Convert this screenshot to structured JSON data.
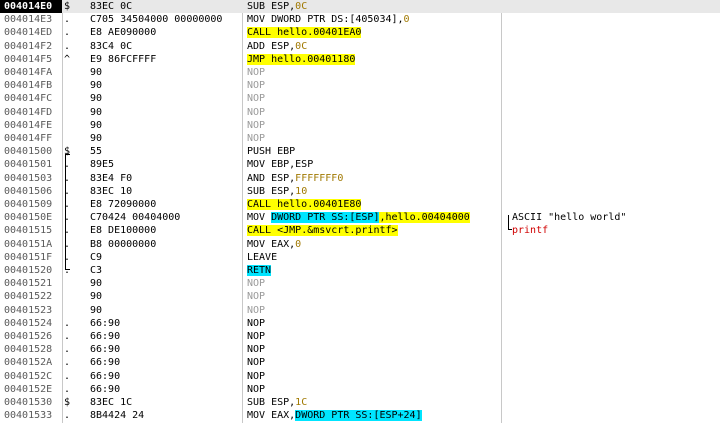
{
  "rows": [
    {
      "addr": "004014E0",
      "mark": "$",
      "hex": "83EC 0C",
      "asm": [
        {
          "t": "SUB ESP,"
        },
        {
          "t": "0C",
          "c": "num"
        }
      ],
      "cmt": [],
      "sel": true
    },
    {
      "addr": "004014E3",
      "mark": ".",
      "hex": "C705 34504000 00000000",
      "asm": [
        {
          "t": "MOV DWORD PTR DS:[405034],"
        },
        {
          "t": "0",
          "c": "num"
        }
      ],
      "cmt": []
    },
    {
      "addr": "004014ED",
      "mark": ".",
      "hex": "E8 AE090000",
      "asm": [
        {
          "t": "CALL hello.00401EA0",
          "c": "hl-y"
        }
      ],
      "cmt": []
    },
    {
      "addr": "004014F2",
      "mark": ".",
      "hex": "83C4 0C",
      "asm": [
        {
          "t": "ADD ESP,"
        },
        {
          "t": "0C",
          "c": "num"
        }
      ],
      "cmt": []
    },
    {
      "addr": "004014F5",
      "mark": "^",
      "hex": "E9 86FCFFFF",
      "asm": [
        {
          "t": "JMP hello.00401180",
          "c": "hl-y"
        }
      ],
      "cmt": []
    },
    {
      "addr": "004014FA",
      "mark": "",
      "hex": "90",
      "asm": [
        {
          "t": "NOP",
          "c": "gray"
        }
      ],
      "cmt": []
    },
    {
      "addr": "004014FB",
      "mark": "",
      "hex": "90",
      "asm": [
        {
          "t": "NOP",
          "c": "gray"
        }
      ],
      "cmt": []
    },
    {
      "addr": "004014FC",
      "mark": "",
      "hex": "90",
      "asm": [
        {
          "t": "NOP",
          "c": "gray"
        }
      ],
      "cmt": []
    },
    {
      "addr": "004014FD",
      "mark": "",
      "hex": "90",
      "asm": [
        {
          "t": "NOP",
          "c": "gray"
        }
      ],
      "cmt": []
    },
    {
      "addr": "004014FE",
      "mark": "",
      "hex": "90",
      "asm": [
        {
          "t": "NOP",
          "c": "gray"
        }
      ],
      "cmt": []
    },
    {
      "addr": "004014FF",
      "mark": "",
      "hex": "90",
      "asm": [
        {
          "t": "NOP",
          "c": "gray"
        }
      ],
      "cmt": []
    },
    {
      "addr": "00401500",
      "mark": "$",
      "hex": "55",
      "asm": [
        {
          "t": "PUSH EBP"
        }
      ],
      "cmt": []
    },
    {
      "addr": "00401501",
      "mark": ".",
      "hex": "89E5",
      "asm": [
        {
          "t": "MOV EBP,ESP"
        }
      ],
      "cmt": []
    },
    {
      "addr": "00401503",
      "mark": ".",
      "hex": "83E4 F0",
      "asm": [
        {
          "t": "AND ESP,"
        },
        {
          "t": "FFFFFFF0",
          "c": "num"
        }
      ],
      "cmt": []
    },
    {
      "addr": "00401506",
      "mark": ".",
      "hex": "83EC 10",
      "asm": [
        {
          "t": "SUB ESP,"
        },
        {
          "t": "10",
          "c": "num"
        }
      ],
      "cmt": []
    },
    {
      "addr": "00401509",
      "mark": ".",
      "hex": "E8 72090000",
      "asm": [
        {
          "t": "CALL hello.00401E80",
          "c": "hl-y"
        }
      ],
      "cmt": []
    },
    {
      "addr": "0040150E",
      "mark": ".",
      "hex": "C70424 00404000",
      "asm": [
        {
          "t": "MOV "
        },
        {
          "t": "DWORD PTR SS:[ESP]",
          "c": "hl-c"
        },
        {
          "t": ",hello.00404000",
          "c": "hl-y"
        }
      ],
      "cmt": [
        {
          "t": "ASCII \"hello world\""
        }
      ]
    },
    {
      "addr": "00401515",
      "mark": ".",
      "hex": "E8 DE100000",
      "asm": [
        {
          "t": "CALL ",
          "c": "hl-y"
        },
        {
          "t": "<JMP.&msvcrt.printf>",
          "c": "hl-y"
        }
      ],
      "cmt": [
        {
          "t": "printf",
          "c": "red"
        }
      ]
    },
    {
      "addr": "0040151A",
      "mark": ".",
      "hex": "B8 00000000",
      "asm": [
        {
          "t": "MOV EAX,"
        },
        {
          "t": "0",
          "c": "num"
        }
      ],
      "cmt": []
    },
    {
      "addr": "0040151F",
      "mark": ".",
      "hex": "C9",
      "asm": [
        {
          "t": "LEAVE"
        }
      ],
      "cmt": []
    },
    {
      "addr": "00401520",
      "mark": ".",
      "hex": "C3",
      "asm": [
        {
          "t": "RETN",
          "c": "hl-c"
        }
      ],
      "cmt": []
    },
    {
      "addr": "00401521",
      "mark": "",
      "hex": "90",
      "asm": [
        {
          "t": "NOP",
          "c": "gray"
        }
      ],
      "cmt": []
    },
    {
      "addr": "00401522",
      "mark": "",
      "hex": "90",
      "asm": [
        {
          "t": "NOP",
          "c": "gray"
        }
      ],
      "cmt": []
    },
    {
      "addr": "00401523",
      "mark": "",
      "hex": "90",
      "asm": [
        {
          "t": "NOP",
          "c": "gray"
        }
      ],
      "cmt": []
    },
    {
      "addr": "00401524",
      "mark": ".",
      "hex": "66:90",
      "asm": [
        {
          "t": "NOP"
        }
      ],
      "cmt": []
    },
    {
      "addr": "00401526",
      "mark": ".",
      "hex": "66:90",
      "asm": [
        {
          "t": "NOP"
        }
      ],
      "cmt": []
    },
    {
      "addr": "00401528",
      "mark": ".",
      "hex": "66:90",
      "asm": [
        {
          "t": "NOP"
        }
      ],
      "cmt": []
    },
    {
      "addr": "0040152A",
      "mark": ".",
      "hex": "66:90",
      "asm": [
        {
          "t": "NOP"
        }
      ],
      "cmt": []
    },
    {
      "addr": "0040152C",
      "mark": ".",
      "hex": "66:90",
      "asm": [
        {
          "t": "NOP"
        }
      ],
      "cmt": []
    },
    {
      "addr": "0040152E",
      "mark": ".",
      "hex": "66:90",
      "asm": [
        {
          "t": "NOP"
        }
      ],
      "cmt": []
    },
    {
      "addr": "00401530",
      "mark": "$",
      "hex": "83EC 1C",
      "asm": [
        {
          "t": "SUB ESP,"
        },
        {
          "t": "1C",
          "c": "num"
        }
      ],
      "cmt": []
    },
    {
      "addr": "00401533",
      "mark": ".",
      "hex": "8B4424 24",
      "asm": [
        {
          "t": "MOV EAX,"
        },
        {
          "t": "DWORD PTR SS:[ESP+24]",
          "c": "hl-c"
        }
      ],
      "cmt": []
    }
  ],
  "colors": {
    "call_highlight": "#ffff00",
    "mem_highlight": "#00e5ff",
    "api_comment": "#d00000",
    "constant": "#a07800"
  }
}
